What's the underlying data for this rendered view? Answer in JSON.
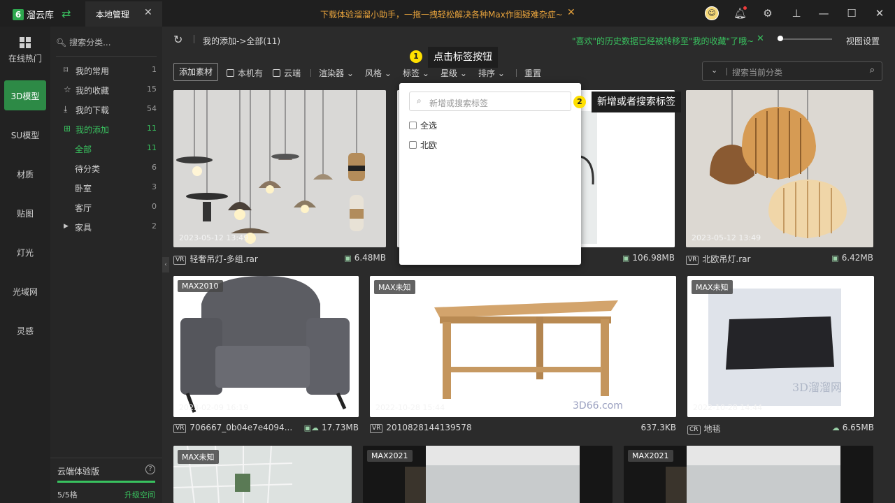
{
  "app": {
    "name": "溜云库",
    "tab_label": "本地管理"
  },
  "promo": {
    "text": "下载体验溜溜小助手，一拖一拽轻松解决各种Max作图疑难杂症~"
  },
  "rail": {
    "items": [
      "在线热门",
      "3D模型",
      "SU模型",
      "材质",
      "贴图",
      "灯光",
      "光域网",
      "灵感"
    ]
  },
  "categories": {
    "search_placeholder": "搜索分类...",
    "items": [
      {
        "label": "我的常用",
        "count": "1"
      },
      {
        "label": "我的收藏",
        "count": "15"
      },
      {
        "label": "我的下载",
        "count": "54"
      },
      {
        "label": "我的添加",
        "count": "11"
      }
    ],
    "sub_items": [
      {
        "label": "全部",
        "count": "11"
      },
      {
        "label": "待分类",
        "count": "6"
      },
      {
        "label": "卧室",
        "count": "3"
      },
      {
        "label": "客厅",
        "count": "0"
      },
      {
        "label": "家具",
        "count": "2"
      }
    ],
    "cloud": {
      "title": "云端体验版",
      "used": "5/5格",
      "upgrade": "升级空间"
    }
  },
  "header": {
    "breadcrumb": "我的添加->全部(11)",
    "notice": "\"喜欢\"的历史数据已经被转移至\"我的收藏\"了哦~",
    "view_settings": "视图设置"
  },
  "filters": {
    "add_button": "添加素材",
    "local": "本机有",
    "cloud": "云端",
    "renderer": "渲染器",
    "style": "风格",
    "tags": "标签",
    "stars": "星级",
    "sort": "排序",
    "reset": "重置",
    "search_placeholder": "搜索当前分类"
  },
  "tag_popup": {
    "search_placeholder": "新增或搜索标签",
    "options": [
      "全选",
      "北欧"
    ]
  },
  "callouts": {
    "step1": {
      "num": "1",
      "text": "点击标签按钮"
    },
    "step2": {
      "num": "2",
      "text": "新增或者搜索标签"
    }
  },
  "cards": [
    {
      "date": "2023-05-12 13:49",
      "badge": "VR",
      "name": "轻奢吊灯-多组.rar",
      "size": "6.48MB"
    },
    {
      "date": "",
      "badge": "",
      "name": "",
      "size": "106.98MB"
    },
    {
      "date": "2023-05-12 13:49",
      "badge": "VR",
      "name": "北欧吊灯.rar",
      "size": "6.42MB"
    },
    {
      "tag": "MAX2010",
      "date": "2023-02-09 16:19",
      "badge": "VR",
      "name": "706667_0b04e7e4094...",
      "size": "17.73MB"
    },
    {
      "tag": "MAX未知",
      "date": "2022-10-28 15:44",
      "badge": "VR",
      "name": "2010828144139578",
      "size": "637.3KB"
    },
    {
      "tag": "MAX未知",
      "date": "2022-10-28 14:44",
      "badge": "CR",
      "name": "地毯",
      "size": "6.65MB"
    },
    {
      "tag": "MAX未知"
    },
    {
      "tag": "MAX2021"
    },
    {
      "tag": "MAX2021"
    }
  ],
  "colors": {
    "accent": "#39c25f",
    "promo": "#e6a23c",
    "callout_dot": "#ffe000"
  }
}
